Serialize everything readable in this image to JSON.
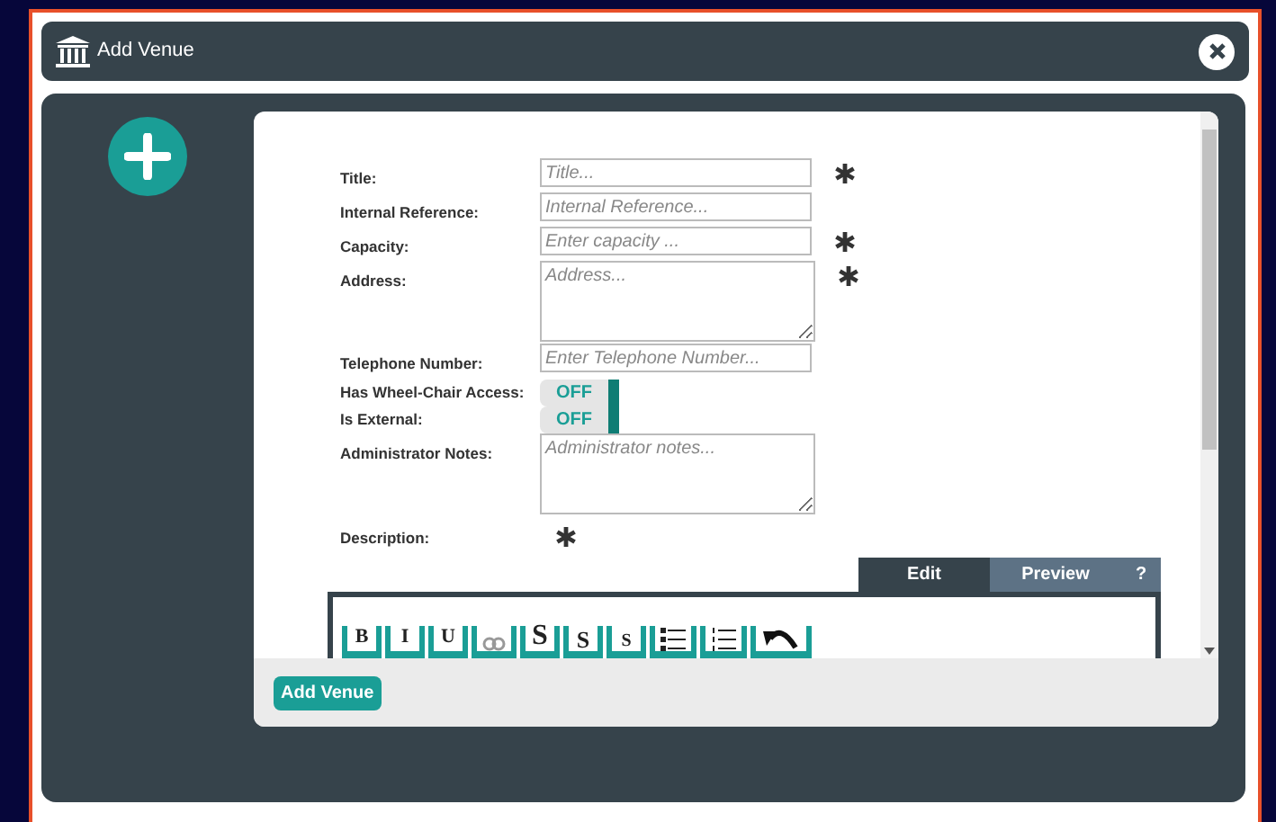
{
  "window": {
    "title": "Add Venue"
  },
  "fields": [
    {
      "kind": "text",
      "label": "Title:",
      "placeholder": "Title...",
      "required": true
    },
    {
      "kind": "text",
      "label": "Internal Reference:",
      "placeholder": "Internal Reference...",
      "required": false
    },
    {
      "kind": "text",
      "label": "Capacity:",
      "placeholder": "Enter capacity ...",
      "required": true
    },
    {
      "kind": "textarea",
      "label": "Address:",
      "placeholder": "Address...",
      "required": true
    },
    {
      "kind": "text",
      "label": "Telephone Number:",
      "placeholder": "Enter Telephone Number...",
      "required": false
    },
    {
      "kind": "toggle",
      "label": "Has Wheel-Chair Access:",
      "on": false,
      "state_text": "OFF"
    },
    {
      "kind": "toggle",
      "label": "Is External:",
      "on": false,
      "state_text": "OFF"
    },
    {
      "kind": "textarea",
      "label": "Administrator Notes:",
      "placeholder": "Administrator notes...",
      "required": false
    }
  ],
  "description": {
    "label": "Description:",
    "required": true
  },
  "editor_tabs": [
    {
      "label": "Edit",
      "selected": true
    },
    {
      "label": "Preview",
      "selected": false
    },
    {
      "label": "?",
      "selected": false
    }
  ],
  "toolbar": [
    {
      "kind": "bold",
      "label": "B"
    },
    {
      "kind": "italic",
      "label": "I"
    },
    {
      "kind": "underline",
      "label": "U"
    },
    {
      "kind": "link"
    },
    {
      "kind": "large",
      "label": "S"
    },
    {
      "kind": "medium",
      "label": "S"
    },
    {
      "kind": "small",
      "label": "S"
    },
    {
      "kind": "bullets"
    },
    {
      "kind": "numbers"
    },
    {
      "kind": "undo"
    }
  ],
  "submit": "Add Venue"
}
